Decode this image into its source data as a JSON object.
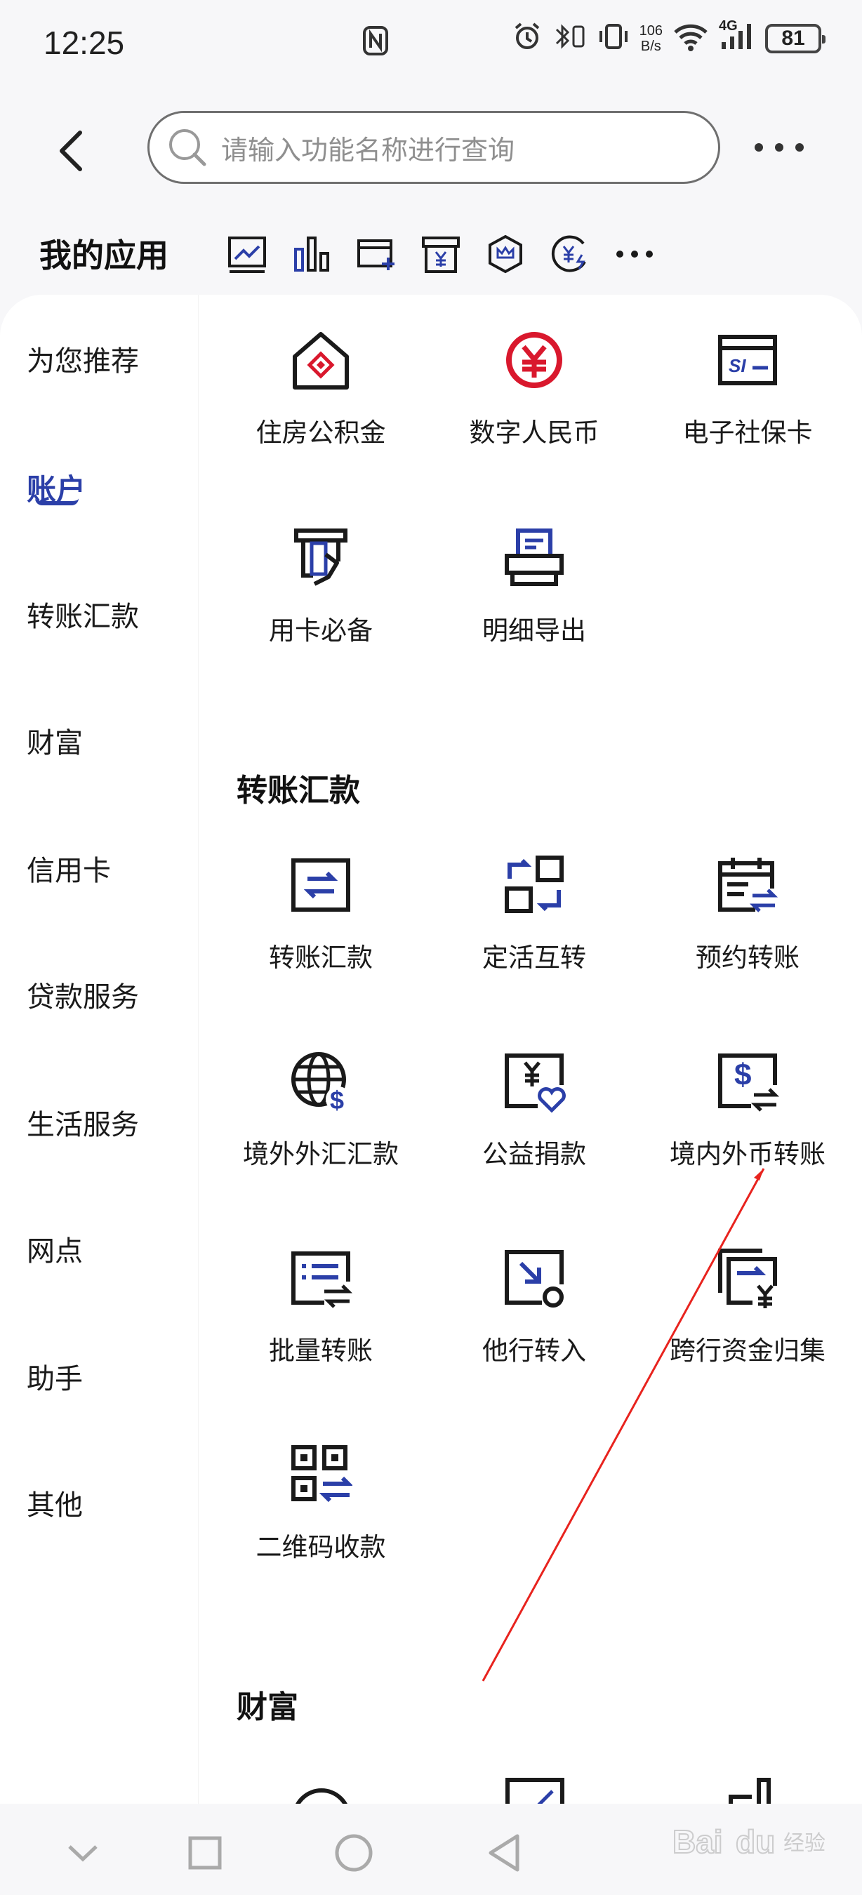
{
  "status_bar": {
    "time": "12:25",
    "net_speed_top": "106",
    "net_speed_bottom": "B/s",
    "network": "4G",
    "battery": "81"
  },
  "header": {
    "search_placeholder": "请输入功能名称进行查询"
  },
  "my_apps": {
    "title": "我的应用",
    "icons": [
      "stock-chart-icon",
      "bar-chart-icon",
      "add-card-icon",
      "yuan-box-icon",
      "crown-hex-icon",
      "yuan-exchange-icon",
      "more-icon"
    ]
  },
  "sidebar": {
    "items": [
      "为您推荐",
      "账户",
      "转账汇款",
      "财富",
      "信用卡",
      "贷款服务",
      "生活服务",
      "网点",
      "助手",
      "其他"
    ],
    "active": "账户"
  },
  "sections": {
    "account_apps": [
      "住房公积金",
      "数字人民币",
      "电子社保卡",
      "用卡必备",
      "明细导出"
    ],
    "transfer": {
      "title": "转账汇款",
      "apps": [
        "转账汇款",
        "定活互转",
        "预约转账",
        "境外外汇汇款",
        "公益捐款",
        "境内外币转账",
        "批量转账",
        "他行转入",
        "跨行资金归集",
        "二维码收款"
      ]
    },
    "wealth": {
      "title": "财富"
    }
  },
  "colors": {
    "accent": "#2b3fa8",
    "icon_black": "#1a1a1a",
    "ecny_red": "#d9182d",
    "annotation": "#e8231e"
  }
}
